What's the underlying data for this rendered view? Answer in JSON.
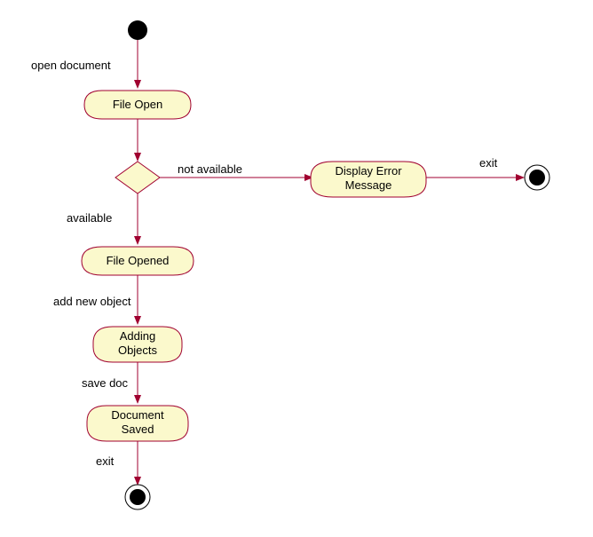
{
  "colors": {
    "nodeFill": "#fbf9cc",
    "nodeStroke": "#a00030",
    "arrowStroke": "#a00030",
    "black": "#000000"
  },
  "nodes": {
    "fileOpen": "File Open",
    "displayError": "Display Error\nMessage",
    "fileOpened": "File Opened",
    "addingObjects": "Adding\nObjects",
    "documentSaved": "Document\nSaved"
  },
  "edges": {
    "openDocument": "open document",
    "notAvailable": "not available",
    "available": "available",
    "addNewObject": "add new object",
    "saveDoc": "save doc",
    "exitLeft": "exit",
    "exitRight": "exit"
  }
}
